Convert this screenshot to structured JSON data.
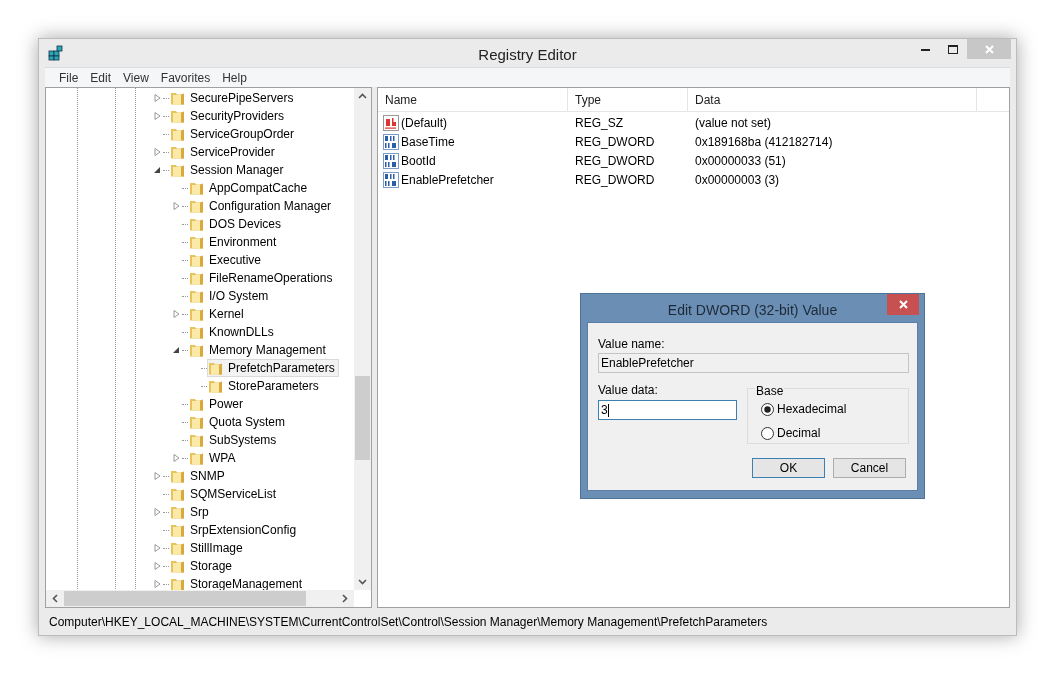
{
  "window": {
    "title": "Registry Editor"
  },
  "menu": [
    "File",
    "Edit",
    "View",
    "Favorites",
    "Help"
  ],
  "tree": [
    {
      "label": "SecurePipeServers",
      "kind": "branch",
      "expanded": false,
      "selected": false
    },
    {
      "label": "SecurityProviders",
      "kind": "branch",
      "expanded": false,
      "selected": false
    },
    {
      "label": "ServiceGroupOrder",
      "kind": "leaf",
      "selected": false
    },
    {
      "label": "ServiceProvider",
      "kind": "branch",
      "expanded": false,
      "selected": false
    },
    {
      "label": "Session Manager",
      "kind": "branch",
      "expanded": true,
      "selected": false,
      "children": [
        {
          "label": "AppCompatCache",
          "kind": "leaf",
          "selected": false
        },
        {
          "label": "Configuration Manager",
          "kind": "branch",
          "expanded": false,
          "selected": false
        },
        {
          "label": "DOS Devices",
          "kind": "leaf",
          "selected": false
        },
        {
          "label": "Environment",
          "kind": "leaf",
          "selected": false
        },
        {
          "label": "Executive",
          "kind": "leaf",
          "selected": false
        },
        {
          "label": "FileRenameOperations",
          "kind": "leaf",
          "selected": false
        },
        {
          "label": "I/O System",
          "kind": "leaf",
          "selected": false
        },
        {
          "label": "Kernel",
          "kind": "branch",
          "expanded": false,
          "selected": false
        },
        {
          "label": "KnownDLLs",
          "kind": "leaf",
          "selected": false
        },
        {
          "label": "Memory Management",
          "kind": "branch",
          "expanded": true,
          "selected": false,
          "children": [
            {
              "label": "PrefetchParameters",
              "kind": "leaf",
              "selected": true
            },
            {
              "label": "StoreParameters",
              "kind": "leaf",
              "selected": false
            }
          ]
        },
        {
          "label": "Power",
          "kind": "leaf",
          "selected": false
        },
        {
          "label": "Quota System",
          "kind": "leaf",
          "selected": false
        },
        {
          "label": "SubSystems",
          "kind": "leaf",
          "selected": false
        },
        {
          "label": "WPA",
          "kind": "branch",
          "expanded": false,
          "selected": false
        }
      ]
    },
    {
      "label": "SNMP",
      "kind": "branch",
      "expanded": false,
      "selected": false
    },
    {
      "label": "SQMServiceList",
      "kind": "leaf",
      "selected": false
    },
    {
      "label": "Srp",
      "kind": "branch",
      "expanded": false,
      "selected": false
    },
    {
      "label": "SrpExtensionConfig",
      "kind": "leaf",
      "selected": false
    },
    {
      "label": "StillImage",
      "kind": "branch",
      "expanded": false,
      "selected": false
    },
    {
      "label": "Storage",
      "kind": "branch",
      "expanded": false,
      "selected": false
    },
    {
      "label": "StorageManagement",
      "kind": "branch",
      "expanded": false,
      "selected": false
    }
  ],
  "values": {
    "columns": [
      "Name",
      "Type",
      "Data"
    ],
    "rows": [
      {
        "kind": "string",
        "name": "(Default)",
        "type": "REG_SZ",
        "data": "(value not set)"
      },
      {
        "kind": "binary",
        "name": "BaseTime",
        "type": "REG_DWORD",
        "data": "0x189168ba (412182714)"
      },
      {
        "kind": "binary",
        "name": "BootId",
        "type": "REG_DWORD",
        "data": "0x00000033 (51)"
      },
      {
        "kind": "binary",
        "name": "EnablePrefetcher",
        "type": "REG_DWORD",
        "data": "0x00000003 (3)"
      }
    ]
  },
  "status_bar": "Computer\\HKEY_LOCAL_MACHINE\\SYSTEM\\CurrentControlSet\\Control\\Session Manager\\Memory Management\\PrefetchParameters",
  "dialog": {
    "title": "Edit DWORD (32-bit) Value",
    "value_name_label": "Value name:",
    "value_name": "EnablePrefetcher",
    "value_data_label": "Value data:",
    "value_data": "3",
    "base_label": "Base",
    "base_options": [
      {
        "label": "Hexadecimal",
        "selected": true
      },
      {
        "label": "Decimal",
        "selected": false
      }
    ],
    "buttons": [
      "OK",
      "Cancel"
    ]
  }
}
